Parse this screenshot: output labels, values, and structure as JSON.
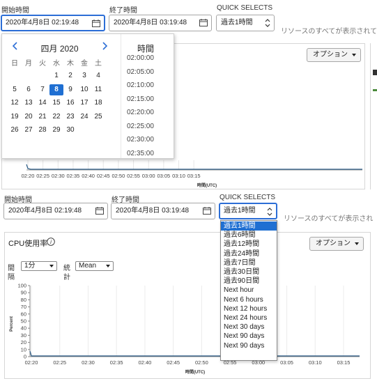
{
  "colors": {
    "accent": "#1f6fd2",
    "line": "#2a5b86"
  },
  "top": {
    "start_label": "開始時間",
    "start_value": "2020年4月8日 02:19:48",
    "end_label": "終了時間",
    "end_value": "2020年4月8日 03:19:48",
    "quick_label": "QUICK SELECTS",
    "quick_value": "過去1時間",
    "note": "リソースのすべてが表示されて",
    "options_label": "オプション"
  },
  "calendar": {
    "month": "四月 2020",
    "weekdays": [
      "日",
      "月",
      "火",
      "水",
      "木",
      "金",
      "土"
    ],
    "weeks": [
      [
        "",
        "",
        "",
        "1",
        "2",
        "3",
        "4"
      ],
      [
        "5",
        "6",
        "7",
        "8",
        "9",
        "10",
        "11"
      ],
      [
        "12",
        "13",
        "14",
        "15",
        "16",
        "17",
        "18"
      ],
      [
        "19",
        "20",
        "21",
        "22",
        "23",
        "24",
        "25"
      ],
      [
        "26",
        "27",
        "28",
        "29",
        "30",
        "",
        ""
      ]
    ],
    "selected": "8",
    "time_header": "時間",
    "times": [
      "02:00:00",
      "02:05:00",
      "02:10:00",
      "02:15:00",
      "02:20:00",
      "02:25:00",
      "02:30:00",
      "02:35:00"
    ]
  },
  "top_chart": {
    "x_ticks": [
      "02:20",
      "02:25",
      "02:30",
      "02:35",
      "02:40",
      "02:45",
      "02:50",
      "02:55",
      "03:00",
      "03:05",
      "03:10",
      "03:15"
    ],
    "xlabel": "時間(UTC)"
  },
  "bottom": {
    "start_label": "開始時間",
    "start_value": "2020年4月8日 02:19:48",
    "end_label": "終了時間",
    "end_value": "2020年4月8日 03:19:48",
    "quick_label": "QUICK SELECTS",
    "quick_value": "過去1時間",
    "note": "リソースのすべてが表示され",
    "panel_title": "CPU使用率",
    "options_label": "オプション",
    "interval_label_1": "間",
    "interval_label_2": "隔",
    "interval_value": "1分",
    "stat_label_1": "統",
    "stat_label_2": "計",
    "stat_value": "Mean"
  },
  "quick_options": [
    "過去1時間",
    "過去6時間",
    "過去12時間",
    "過去24時間",
    "過去7日間",
    "過去30日間",
    "過去90日間",
    "Next hour",
    "Next 6 hours",
    "Next 12 hours",
    "Next 24 hours",
    "Next 30 days",
    "Next 90 days",
    "Next 90 days"
  ],
  "chart_data": {
    "type": "line",
    "ylabel": "Percent",
    "xlabel": "時間(UTC)",
    "ylim": [
      0,
      100
    ],
    "y_ticks": [
      "100",
      "90",
      "80",
      "70",
      "60",
      "50",
      "40",
      "30",
      "20",
      "10",
      "0"
    ],
    "categories": [
      "02:20",
      "02:25",
      "02:30",
      "02:35",
      "02:40",
      "02:45",
      "02:50",
      "02:55",
      "03:00",
      "03:05",
      "03:10",
      "03:15"
    ],
    "series": [
      {
        "values": [
          1,
          1,
          1,
          1,
          1,
          1,
          1,
          1,
          1,
          1,
          1,
          1
        ]
      }
    ],
    "grid": true
  }
}
